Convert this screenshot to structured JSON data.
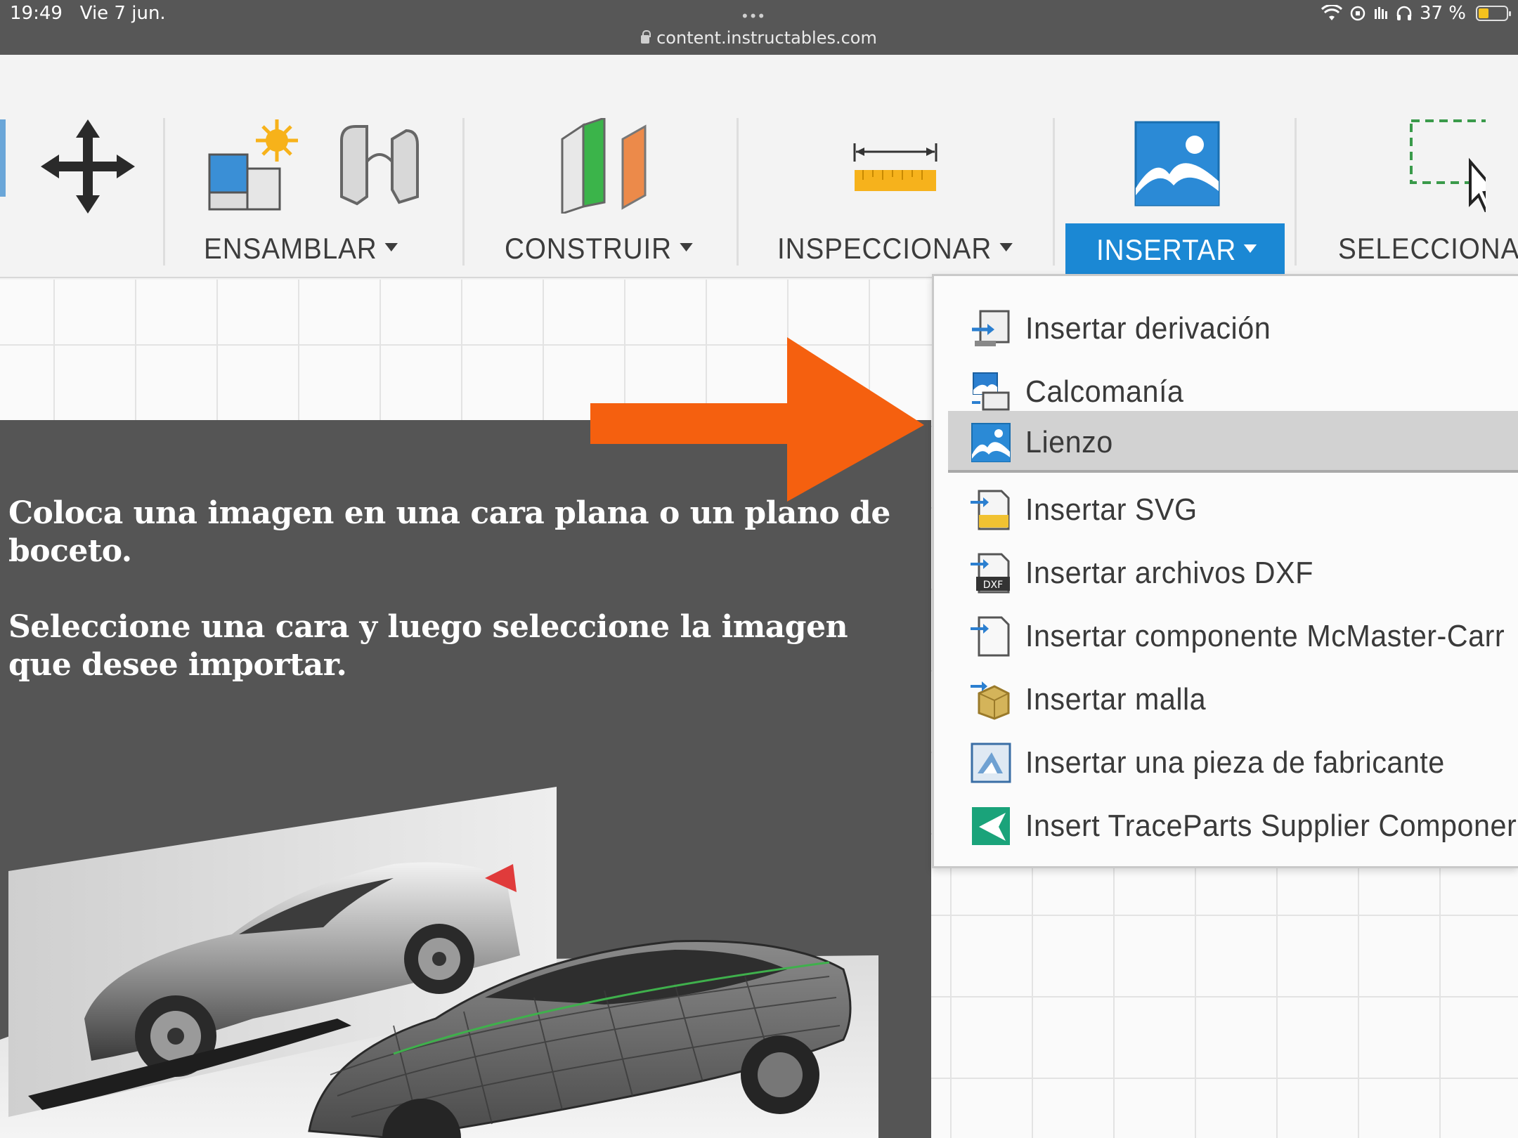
{
  "status_bar": {
    "time": "19:49",
    "date": "Vie 7 jun.",
    "url": "content.instructables.com",
    "battery": "37 %",
    "dots": "•••"
  },
  "toolbar": {
    "groups": [
      {
        "label": "ENSAMBLAR"
      },
      {
        "label": "CONSTRUIR"
      },
      {
        "label": "INSPECCIONAR"
      },
      {
        "label": "INSERTAR"
      },
      {
        "label": "SELECCIONA"
      }
    ],
    "active_color": "#1b88d4"
  },
  "tooltip": {
    "line1": "Coloca una imagen en una cara plana o un plano de boceto.",
    "line2": "Seleccione una cara y luego seleccione la imagen que desee importar."
  },
  "arrow_color": "#f5600f",
  "menu": {
    "items": [
      {
        "label": "Insertar derivación",
        "icon": "insert-derive-icon"
      },
      {
        "label": "Calcomanía",
        "icon": "decal-icon"
      },
      {
        "label": "Lienzo",
        "icon": "canvas-icon",
        "highlighted": true
      },
      {
        "label": "Insertar SVG",
        "icon": "svg-file-icon"
      },
      {
        "label": "Insertar archivos DXF",
        "icon": "dxf-file-icon"
      },
      {
        "label": "Insertar componente McMaster-Carr",
        "icon": "mcmaster-icon"
      },
      {
        "label": "Insertar malla",
        "icon": "mesh-icon"
      },
      {
        "label": "Insertar una pieza de fabricante",
        "icon": "manufacturer-part-icon"
      },
      {
        "label": "Insert TraceParts Supplier Componer",
        "icon": "traceparts-icon"
      }
    ]
  }
}
